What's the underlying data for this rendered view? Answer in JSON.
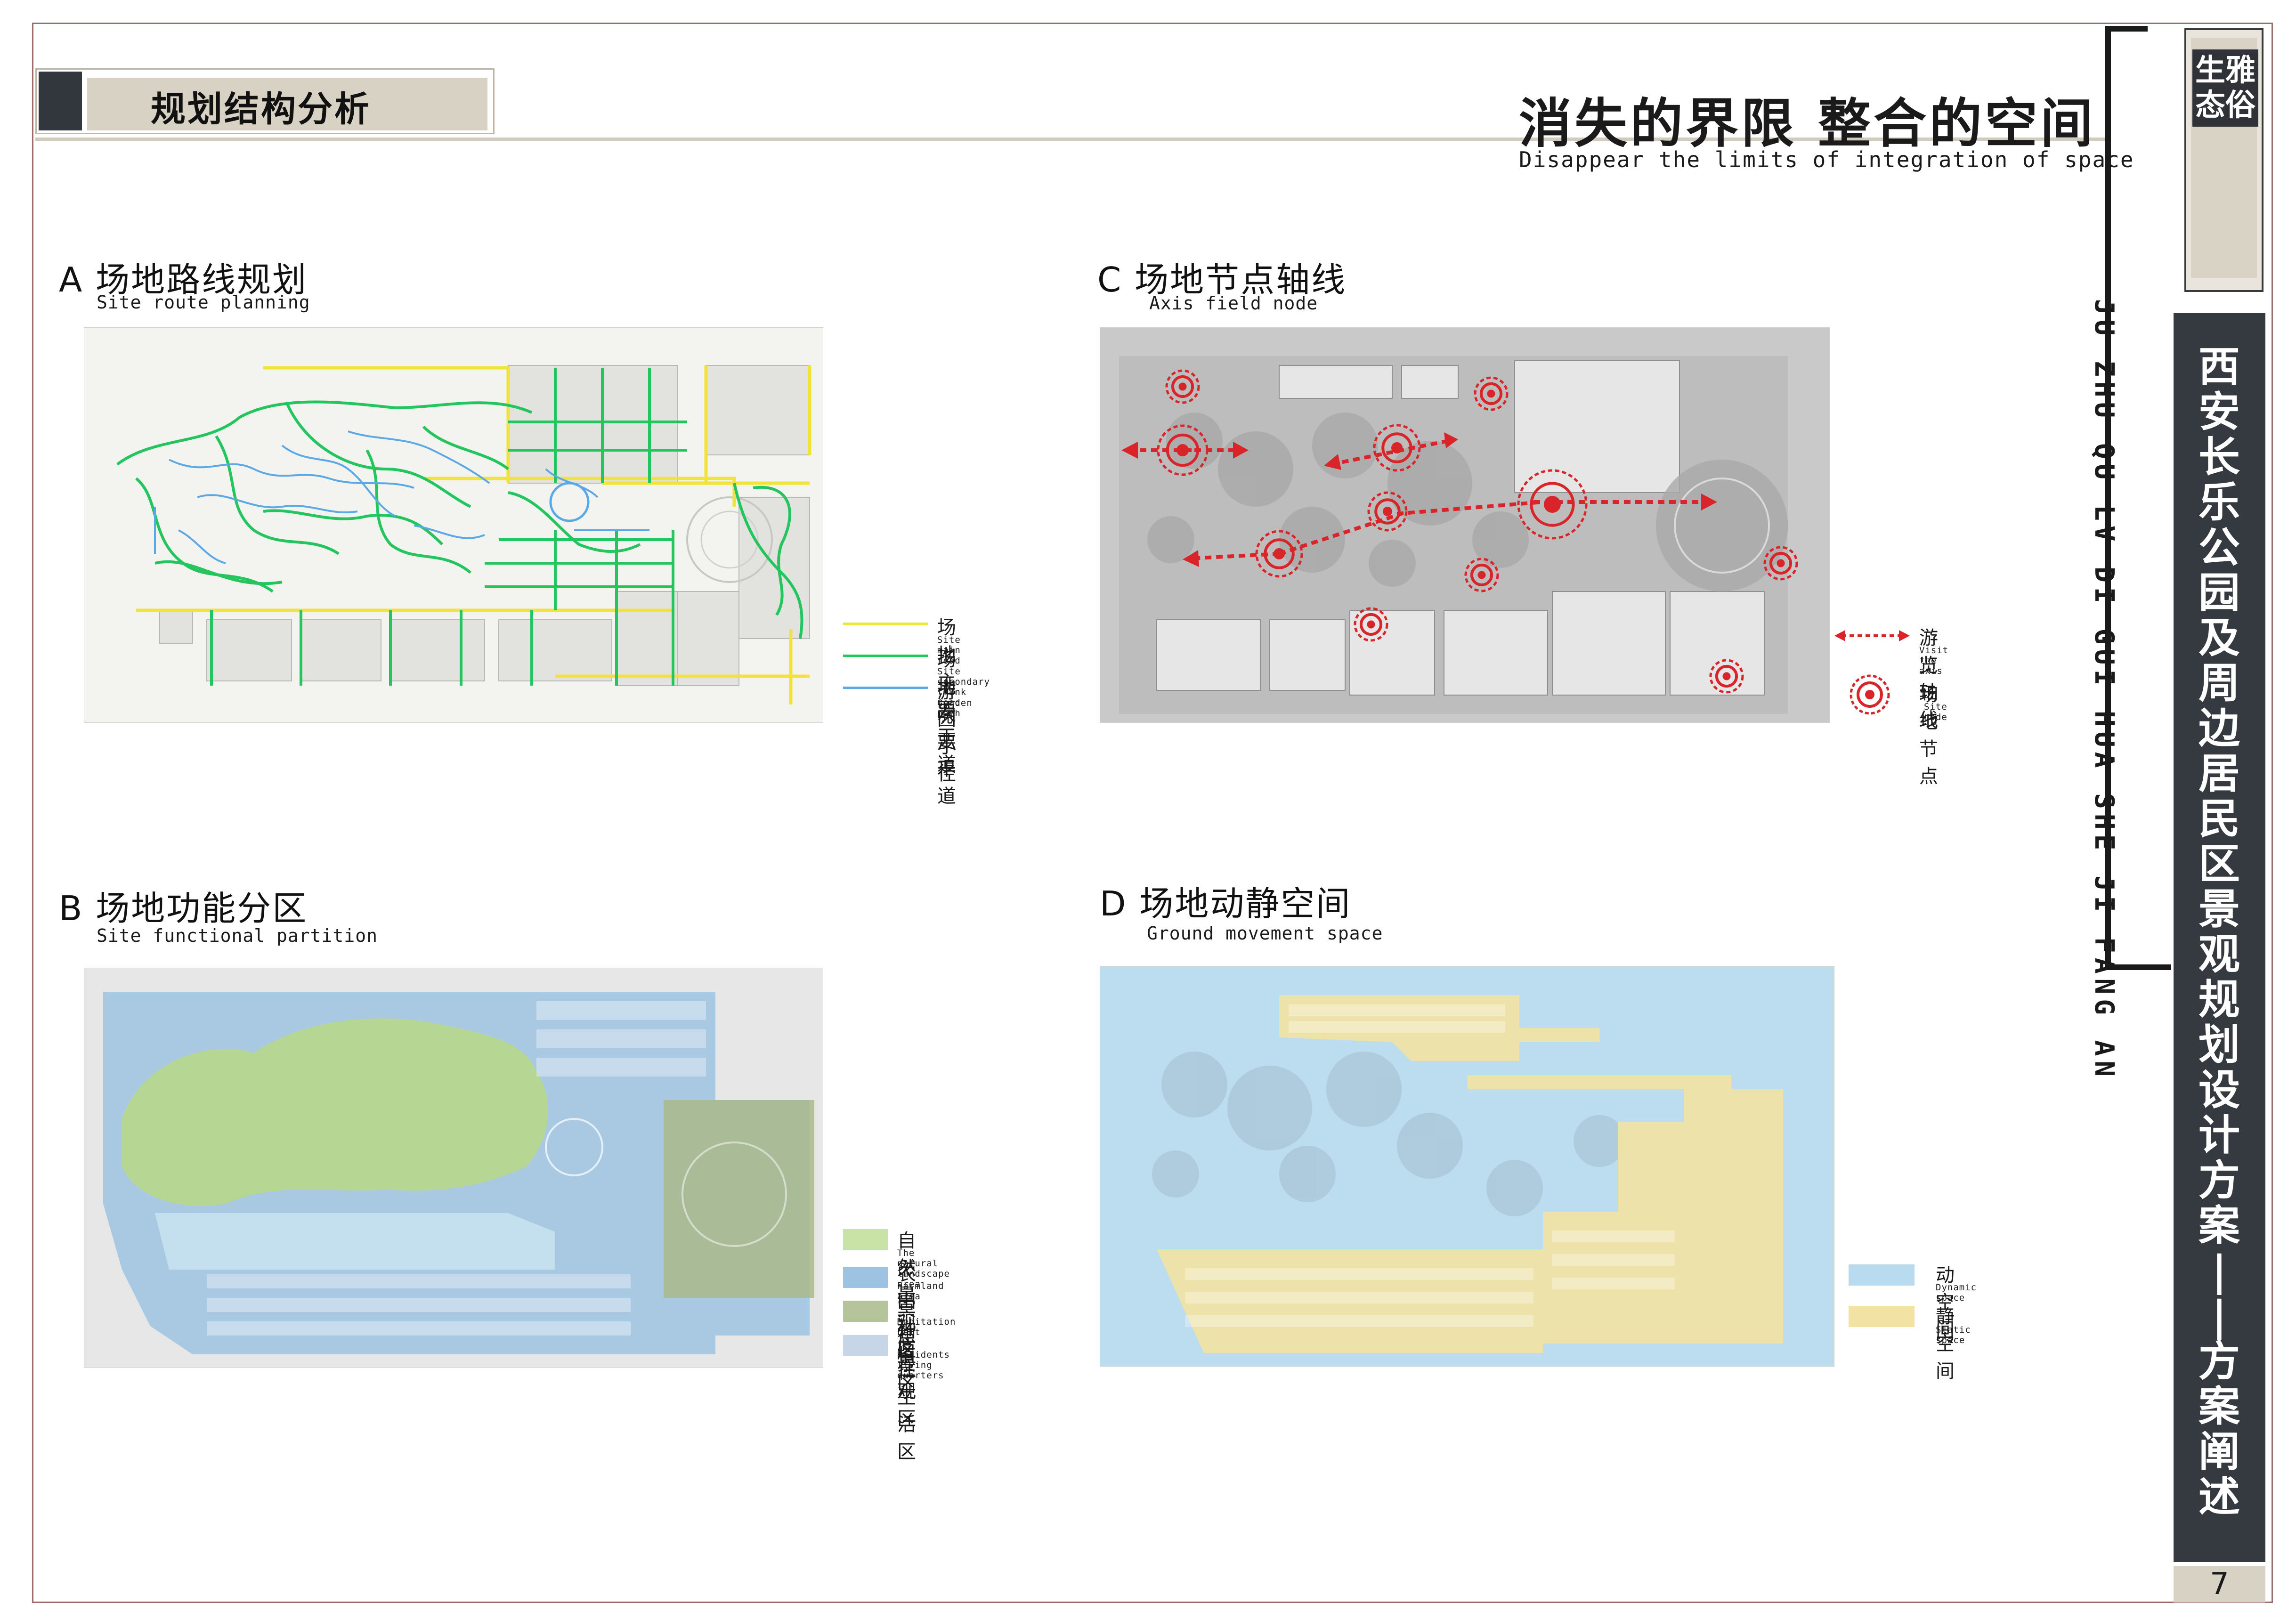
{
  "header": {
    "section_label": "规划结构分析",
    "main_title": "消失的界限 整合的空间",
    "main_subtitle": "Disappear the limits of integration of space"
  },
  "sidebar": {
    "logo_text": "生雅\n态俗",
    "vertical_title": "西安长乐公园及周边居民区景观规划设计方案——方案阐述",
    "pinyin": "JU ZHU QU LV DI GUI HUA SHE JI FANG AN",
    "page_number": "7"
  },
  "sections": {
    "a": {
      "title": "A 场地路线规划",
      "subtitle": "Site route planning"
    },
    "b": {
      "title": "B 场地功能分区",
      "subtitle": "Site functional partition"
    },
    "c": {
      "title": "C 场地节点轴线",
      "subtitle": "Axis field node"
    },
    "d": {
      "title": "D 场地动静空间",
      "subtitle": "Ground movement space"
    }
  },
  "legend_a": [
    {
      "label": "场地主要干道",
      "sub": "Site main road",
      "color": "#f2e33a"
    },
    {
      "label": "场地次要干道",
      "sub": "Site secondary trunk road",
      "color": "#22c55e"
    },
    {
      "label": "游园小径",
      "sub": "Garden path",
      "color": "#5aa9e6"
    }
  ],
  "legend_b": [
    {
      "label": "自然景观区",
      "sub": "The natural landscape area",
      "color": "#c9e3a6"
    },
    {
      "label": "农田种植区",
      "sub": "Farmland area",
      "color": "#9ec3e2"
    },
    {
      "label": "冥想景观区",
      "sub": "Meditation belt",
      "color": "#b5c49a"
    },
    {
      "label": "居住生活区",
      "sub": "Residents living quarters",
      "color": "#c6d6e6"
    }
  ],
  "legend_c": [
    {
      "label": "游览轴线",
      "sub": "Visit the axis",
      "color": "#d9252a"
    },
    {
      "label": "场地节点",
      "sub": "Site node",
      "color": "#d9252a"
    }
  ],
  "legend_d": [
    {
      "label": "动空间",
      "sub": "Dynamic space",
      "color": "#b9dbef"
    },
    {
      "label": "静空间",
      "sub": "Static space",
      "color": "#f2e3a5"
    }
  ],
  "colors": {
    "dark_bar": "#353a40",
    "beige": "#d8d2c4",
    "frame": "#9a6b6b"
  }
}
